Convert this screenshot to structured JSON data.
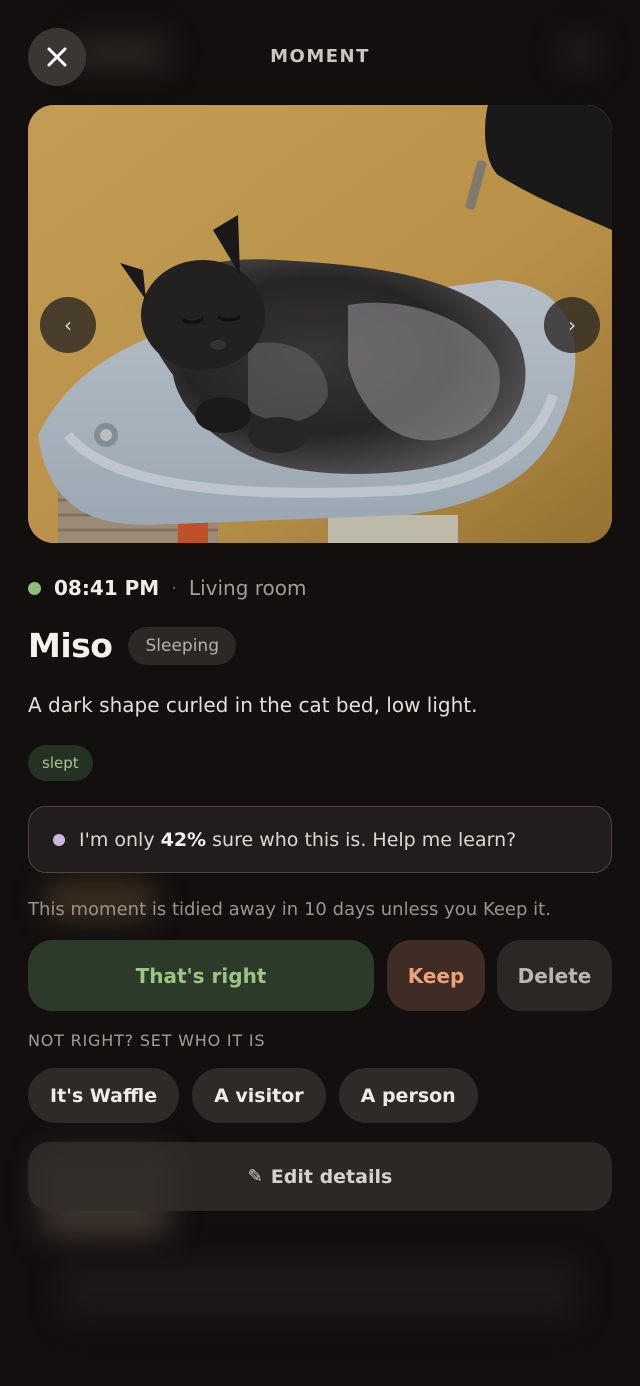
{
  "header": {
    "title": "MOMENT",
    "close_icon": "close-icon"
  },
  "photo": {
    "prev_label": "‹",
    "next_label": "›",
    "subject": "cat-photo"
  },
  "meta": {
    "time": "08:41 PM",
    "separator": "·",
    "room": "Living room",
    "status_color": "#8fbe7c"
  },
  "subject": {
    "name": "Miso",
    "state": "Sleeping"
  },
  "description": "A dark shape curled in the cat bed, low light.",
  "tag": "slept",
  "learn": {
    "prefix": "I'm only ",
    "confidence": "42%",
    "suffix": " sure who this is. Help me learn?"
  },
  "tidy_notice": "This moment is tidied away in 10 days unless you Keep it.",
  "actions": {
    "confirm": "That's right",
    "keep": "Keep",
    "delete": "Delete"
  },
  "not_right_label": "NOT RIGHT? SET WHO IT IS",
  "alternatives": [
    "It's Waffle",
    "A visitor",
    "A person"
  ],
  "edit": {
    "icon": "✎",
    "label": "Edit details"
  },
  "colors": {
    "background": "#120f0e",
    "confirm": "#9cc486",
    "keep": "#eea27c",
    "tag": "#a4c493"
  }
}
